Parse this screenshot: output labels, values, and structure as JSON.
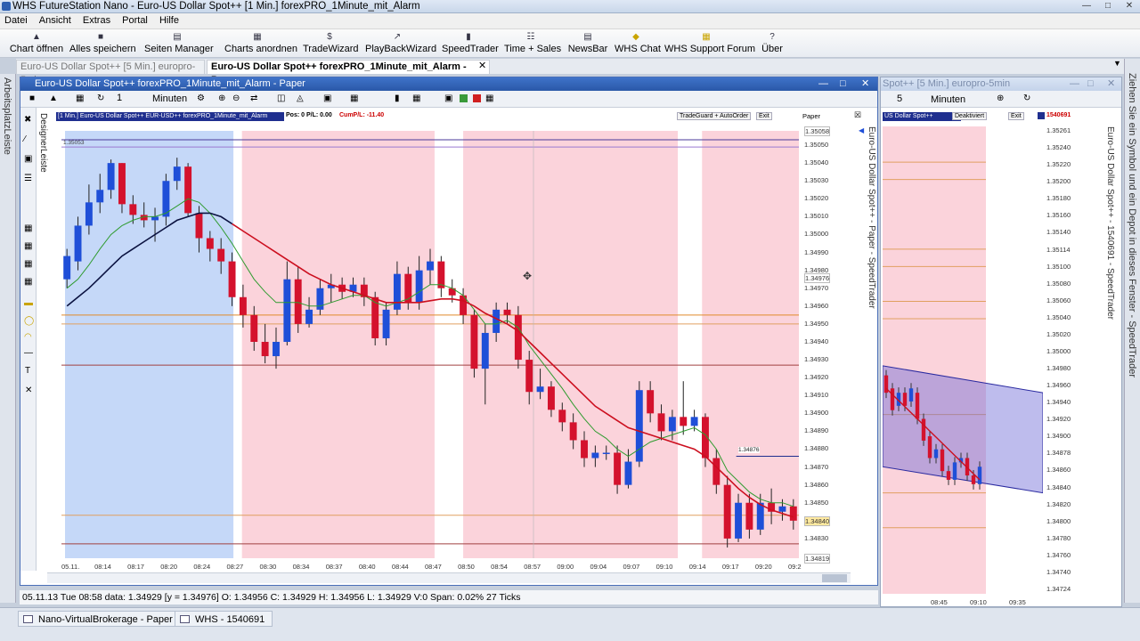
{
  "app": {
    "window_title": "WHS FutureStation Nano - Euro-US Dollar Spot++ [1 Min.]  forexPRO_1Minute_mit_Alarm"
  },
  "menu": [
    "Datei",
    "Ansicht",
    "Extras",
    "Portal",
    "Hilfe"
  ],
  "toolbar": [
    {
      "label": "Chart öffnen",
      "icon": "folder-icon"
    },
    {
      "label": "Alles speichern",
      "icon": "save-icon"
    },
    {
      "label": "Seiten Manager",
      "icon": "pages-icon"
    },
    {
      "label": "Charts anordnen",
      "icon": "grid-icon"
    },
    {
      "label": "TradeWizard",
      "icon": "dollar-icon"
    },
    {
      "label": "PlayBackWizard",
      "icon": "playback-icon"
    },
    {
      "label": "SpeedTrader",
      "icon": "speedtrader-icon"
    },
    {
      "label": "Time + Sales",
      "icon": "timesales-icon"
    },
    {
      "label": "NewsBar",
      "icon": "news-icon"
    },
    {
      "label": "WHS Chat",
      "icon": "chat-icon"
    },
    {
      "label": "WHS Support Forum",
      "icon": "forum-icon"
    },
    {
      "label": "Über",
      "icon": "help-icon"
    }
  ],
  "tabs": [
    {
      "label": "Euro-US Dollar Spot++ [5 Min.]  europro-5min",
      "active": false
    },
    {
      "label": "Euro-US Dollar Spot++   forexPRO_1Minute_mit_Alarm - Paper",
      "active": true
    }
  ],
  "left_strip": {
    "label": "ArbeitsplatzLeiste"
  },
  "right_strip": {
    "label": "Ziehen Sie ein Symbol und ein Depot in dieses Fenster - SpeedTrader"
  },
  "chart_window": {
    "title": "Euro-US Dollar Spot++   forexPRO_1Minute_mit_Alarm - Paper",
    "period_value": "1",
    "period_unit": "Minuten",
    "designer_label": "DesignerLeiste",
    "header_strip": "[1 Min.] Euro-US Dollar Spot++   EUR-USD++ forexPRO_1Minute_mit_Alarm",
    "pos_text": "Pos: 0  P/L: 0.00",
    "cum_text": "CumP/L: -11.40",
    "tradeguard": "TradeGuard + AutoOrder",
    "exit": "Exit",
    "paper": "Paper",
    "alarm_label": "1.35053",
    "price_marker_label": "1.34876",
    "speedtrader_side": "Euro-US Dollar Spot++ - Paper - SpeedTrader",
    "status": "05.11.13 Tue   08:58 data: 1.34929 [y = 1.34976]     O: 1.34956 C: 1.34929 H: 1.34956 L: 1.34929 V:0 Span: 0.02% 27 Ticks"
  },
  "chart_data": {
    "type": "candlestick",
    "ylim": [
      1.34819,
      1.35058
    ],
    "x_ticks": [
      "05.11.",
      "08:14",
      "08:17",
      "08:20",
      "08:24",
      "08:27",
      "08:30",
      "08:34",
      "08:37",
      "08:40",
      "08:44",
      "08:47",
      "08:50",
      "08:54",
      "08:57",
      "09:00",
      "09:04",
      "09:07",
      "09:10",
      "09:14",
      "09:17",
      "09:20",
      "09:2"
    ],
    "y_ticks": [
      1.3505,
      1.3504,
      1.3503,
      1.3502,
      1.3501,
      1.35,
      1.3499,
      1.3498,
      1.3497,
      1.3496,
      1.3495,
      1.3494,
      1.3493,
      1.3492,
      1.3491,
      1.349,
      1.3489,
      1.3488,
      1.3487,
      1.3486,
      1.3485,
      1.3484,
      1.3483
    ],
    "y_tick_labels": [
      "1.35050",
      "1.35040",
      "1.35030",
      "1.35020",
      "1.35010",
      "1.35000",
      "1.34990",
      "1.34980",
      "1.34970",
      "1.34960",
      "1.34950",
      "1.34940",
      "1.34930",
      "1.34920",
      "1.34910",
      "1.34900",
      "1.34890",
      "1.34880",
      "1.34870",
      "1.34860",
      "1.34850",
      "1.34840",
      "1.34830"
    ],
    "y_highlight_labels": {
      "top": "1.35058",
      "mid": "1.34976",
      "current": "1.34840",
      "bottom": "1.34819"
    },
    "candles": [
      {
        "o": 1.34975,
        "c": 1.34988,
        "h": 1.34992,
        "l": 1.3497
      },
      {
        "o": 1.34985,
        "c": 1.35005,
        "h": 1.3501,
        "l": 1.3498
      },
      {
        "o": 1.35005,
        "c": 1.35018,
        "h": 1.35028,
        "l": 1.35
      },
      {
        "o": 1.35018,
        "c": 1.35025,
        "h": 1.35034,
        "l": 1.35012
      },
      {
        "o": 1.35025,
        "c": 1.3504,
        "h": 1.35042,
        "l": 1.3502
      },
      {
        "o": 1.3504,
        "c": 1.35017,
        "h": 1.3504,
        "l": 1.35012
      },
      {
        "o": 1.35017,
        "c": 1.35011,
        "h": 1.35022,
        "l": 1.35006
      },
      {
        "o": 1.35011,
        "c": 1.35008,
        "h": 1.35018,
        "l": 1.35004
      },
      {
        "o": 1.35008,
        "c": 1.3501,
        "h": 1.35015,
        "l": 1.34996
      },
      {
        "o": 1.3501,
        "c": 1.3503,
        "h": 1.35034,
        "l": 1.35005
      },
      {
        "o": 1.3503,
        "c": 1.35038,
        "h": 1.35043,
        "l": 1.35025
      },
      {
        "o": 1.35038,
        "c": 1.35012,
        "h": 1.3504,
        "l": 1.3501
      },
      {
        "o": 1.35012,
        "c": 1.34998,
        "h": 1.35016,
        "l": 1.3499
      },
      {
        "o": 1.34998,
        "c": 1.34992,
        "h": 1.35002,
        "l": 1.34985
      },
      {
        "o": 1.34992,
        "c": 1.34985,
        "h": 1.34998,
        "l": 1.34978
      },
      {
        "o": 1.34985,
        "c": 1.34965,
        "h": 1.3499,
        "l": 1.3496
      },
      {
        "o": 1.34965,
        "c": 1.34955,
        "h": 1.34972,
        "l": 1.34948
      },
      {
        "o": 1.34955,
        "c": 1.3494,
        "h": 1.3496,
        "l": 1.34935
      },
      {
        "o": 1.3494,
        "c": 1.34932,
        "h": 1.3495,
        "l": 1.34928
      },
      {
        "o": 1.34932,
        "c": 1.3494,
        "h": 1.34948,
        "l": 1.34925
      },
      {
        "o": 1.3494,
        "c": 1.34975,
        "h": 1.34985,
        "l": 1.34938
      },
      {
        "o": 1.34975,
        "c": 1.3495,
        "h": 1.34982,
        "l": 1.34945
      },
      {
        "o": 1.3495,
        "c": 1.34958,
        "h": 1.34965,
        "l": 1.34948
      },
      {
        "o": 1.34958,
        "c": 1.3497,
        "h": 1.34975,
        "l": 1.34955
      },
      {
        "o": 1.3497,
        "c": 1.34972,
        "h": 1.34978,
        "l": 1.34962
      },
      {
        "o": 1.34972,
        "c": 1.34968,
        "h": 1.34976,
        "l": 1.34964
      },
      {
        "o": 1.34968,
        "c": 1.34972,
        "h": 1.34976,
        "l": 1.34965
      },
      {
        "o": 1.34972,
        "c": 1.34965,
        "h": 1.34976,
        "l": 1.3496
      },
      {
        "o": 1.34965,
        "c": 1.34942,
        "h": 1.34968,
        "l": 1.34938
      },
      {
        "o": 1.34942,
        "c": 1.34958,
        "h": 1.34962,
        "l": 1.34938
      },
      {
        "o": 1.34958,
        "c": 1.34978,
        "h": 1.34985,
        "l": 1.34955
      },
      {
        "o": 1.34978,
        "c": 1.34962,
        "h": 1.34982,
        "l": 1.34958
      },
      {
        "o": 1.34962,
        "c": 1.3498,
        "h": 1.34988,
        "l": 1.34958
      },
      {
        "o": 1.3498,
        "c": 1.34985,
        "h": 1.34992,
        "l": 1.34972
      },
      {
        "o": 1.34985,
        "c": 1.3497,
        "h": 1.34988,
        "l": 1.34965
      },
      {
        "o": 1.3497,
        "c": 1.34966,
        "h": 1.34975,
        "l": 1.34962
      },
      {
        "o": 1.34966,
        "c": 1.34955,
        "h": 1.3497,
        "l": 1.3495
      },
      {
        "o": 1.34955,
        "c": 1.34925,
        "h": 1.34958,
        "l": 1.3492
      },
      {
        "o": 1.34925,
        "c": 1.34945,
        "h": 1.3495,
        "l": 1.34905
      },
      {
        "o": 1.34945,
        "c": 1.34958,
        "h": 1.34962,
        "l": 1.3494
      },
      {
        "o": 1.34958,
        "c": 1.34955,
        "h": 1.34962,
        "l": 1.3495
      },
      {
        "o": 1.34955,
        "c": 1.3493,
        "h": 1.3496,
        "l": 1.34925
      },
      {
        "o": 1.3493,
        "c": 1.34912,
        "h": 1.34935,
        "l": 1.34905
      },
      {
        "o": 1.34912,
        "c": 1.34915,
        "h": 1.34925,
        "l": 1.34908
      },
      {
        "o": 1.34915,
        "c": 1.34902,
        "h": 1.34918,
        "l": 1.34898
      },
      {
        "o": 1.34902,
        "c": 1.34895,
        "h": 1.34906,
        "l": 1.3489
      },
      {
        "o": 1.34895,
        "c": 1.34885,
        "h": 1.349,
        "l": 1.3488
      },
      {
        "o": 1.34885,
        "c": 1.34875,
        "h": 1.3489,
        "l": 1.3487
      },
      {
        "o": 1.34875,
        "c": 1.34878,
        "h": 1.34882,
        "l": 1.3487
      },
      {
        "o": 1.34878,
        "c": 1.34878,
        "h": 1.34882,
        "l": 1.34874
      },
      {
        "o": 1.34878,
        "c": 1.3486,
        "h": 1.34882,
        "l": 1.34855
      },
      {
        "o": 1.3486,
        "c": 1.34873,
        "h": 1.3488,
        "l": 1.34858
      },
      {
        "o": 1.34873,
        "c": 1.34913,
        "h": 1.34918,
        "l": 1.3487
      },
      {
        "o": 1.34913,
        "c": 1.349,
        "h": 1.34918,
        "l": 1.34895
      },
      {
        "o": 1.349,
        "c": 1.3489,
        "h": 1.34905,
        "l": 1.34885
      },
      {
        "o": 1.3489,
        "c": 1.34898,
        "h": 1.34902,
        "l": 1.34885
      },
      {
        "o": 1.34898,
        "c": 1.34893,
        "h": 1.34918,
        "l": 1.34888
      },
      {
        "o": 1.34893,
        "c": 1.34898,
        "h": 1.34902,
        "l": 1.3489
      },
      {
        "o": 1.34898,
        "c": 1.34875,
        "h": 1.349,
        "l": 1.3487
      },
      {
        "o": 1.34875,
        "c": 1.3486,
        "h": 1.3488,
        "l": 1.34855
      },
      {
        "o": 1.3486,
        "c": 1.3483,
        "h": 1.34865,
        "l": 1.34825
      },
      {
        "o": 1.3483,
        "c": 1.3485,
        "h": 1.34855,
        "l": 1.34828
      },
      {
        "o": 1.3485,
        "c": 1.34835,
        "h": 1.34855,
        "l": 1.3483
      },
      {
        "o": 1.34835,
        "c": 1.3485,
        "h": 1.34855,
        "l": 1.34832
      },
      {
        "o": 1.3485,
        "c": 1.34845,
        "h": 1.34858,
        "l": 1.34838
      },
      {
        "o": 1.34845,
        "c": 1.34848,
        "h": 1.34852,
        "l": 1.3484
      },
      {
        "o": 1.34848,
        "c": 1.3484,
        "h": 1.34852,
        "l": 1.34835
      }
    ],
    "ma_fast": [
      1.3497,
      1.34975,
      1.34983,
      1.34992,
      1.35,
      1.35005,
      1.35008,
      1.3501,
      1.3501,
      1.35012,
      1.35016,
      1.3502,
      1.35018,
      1.35012,
      1.35004,
      1.34995,
      1.34985,
      1.34975,
      1.34968,
      1.34962,
      1.34962,
      1.34962,
      1.3496,
      1.3496,
      1.34962,
      1.34964,
      1.34966,
      1.34966,
      1.34962,
      1.3496,
      1.34962,
      1.34964,
      1.34968,
      1.34972,
      1.34972,
      1.3497,
      1.34966,
      1.34958,
      1.3495,
      1.3495,
      1.34952,
      1.34948,
      1.34938,
      1.3493,
      1.34922,
      1.34914,
      1.34905,
      1.34897,
      1.3489,
      1.34886,
      1.3488,
      1.34876,
      1.3488,
      1.34884,
      1.34886,
      1.34888,
      1.3489,
      1.34892,
      1.34888,
      1.3488,
      1.34868,
      1.34862,
      1.34856,
      1.34852,
      1.3485,
      1.3485,
      1.34848
    ],
    "ma_slow": [
      1.3496,
      1.34965,
      1.3497,
      1.34976,
      1.34982,
      1.34988,
      1.34992,
      1.34996,
      1.35,
      1.35004,
      1.35008,
      1.3501,
      1.35012,
      1.35012,
      1.3501,
      1.35006,
      1.35002,
      1.34998,
      1.34994,
      1.3499,
      1.34986,
      1.34982,
      1.34978,
      1.34975,
      1.34972,
      1.3497,
      1.34968,
      1.34966,
      1.34964,
      1.34962,
      1.34962,
      1.34962,
      1.34962,
      1.34963,
      1.34964,
      1.34964,
      1.34963,
      1.3496,
      1.34956,
      1.34953,
      1.3495,
      1.34946,
      1.3494,
      1.34934,
      1.34928,
      1.34922,
      1.34916,
      1.3491,
      1.34904,
      1.349,
      1.34896,
      1.34892,
      1.3489,
      1.34888,
      1.34886,
      1.34884,
      1.34882,
      1.3488,
      1.34876,
      1.3487,
      1.34864,
      1.34858,
      1.34853,
      1.34849,
      1.34846,
      1.34844,
      1.34842
    ]
  },
  "second_window": {
    "title": "Spot++ [5 Min.]  europro-5min",
    "period_value": "5",
    "period_unit": "Minuten",
    "header_strip": "US Dollar Spot++",
    "deactivated": "Deaktiviert",
    "exit": "Exit",
    "account": "1540691",
    "side_label": "Euro-US Dollar Spot++ - 1540691 - SpeedTrader",
    "y_tick_labels": [
      "1.35261",
      "1.35240",
      "1.35220",
      "1.35200",
      "1.35180",
      "1.35160",
      "1.35140",
      "1.35114",
      "1.35100",
      "1.35080",
      "1.35060",
      "1.35040",
      "1.35020",
      "1.35000",
      "1.34980",
      "1.34960",
      "1.34940",
      "1.34920",
      "1.34900",
      "1.34878",
      "1.34860",
      "1.34840",
      "1.34820",
      "1.34800",
      "1.34780",
      "1.34760",
      "1.34740",
      "1.34724"
    ],
    "x_ticks": [
      "08:45",
      "09:10",
      "09:35"
    ]
  },
  "taskbar": [
    {
      "label": "Nano-VirtualBrokerage - Paper"
    },
    {
      "label": "WHS - 1540691"
    }
  ],
  "colors": {
    "bull": "#1f4fd8",
    "bear": "#d4122d",
    "zone_blue": "#c5d8f8",
    "zone_red": "#fbd3db",
    "ma_fast": "#2f9b2f",
    "ma_slow_early": "#0b1240",
    "ma_slow_late": "#cc0f1f",
    "title_bar": "#2e5fb0"
  }
}
